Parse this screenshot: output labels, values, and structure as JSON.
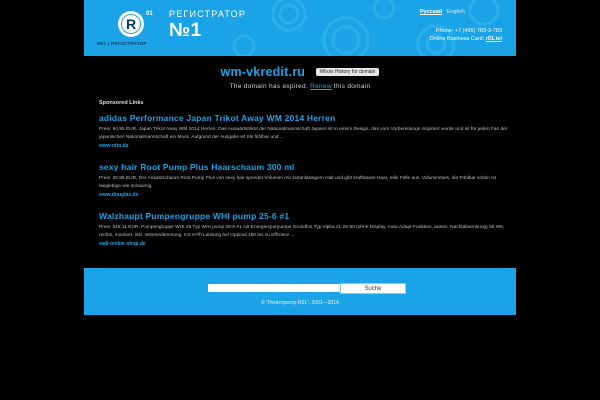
{
  "header": {
    "logo_caption": "R01 | РЕГИСТРАТОР",
    "logo_letter": "R",
    "logo_superscript": "01",
    "brand_title": "РЕГИСТРАТОР",
    "brand_number": "№1",
    "lang_active": "Русский",
    "lang_other": "English",
    "phone": "Phone: +7 (495) 783-3-783",
    "card_label": "Online Business Card: ",
    "card_link": "r01.tel"
  },
  "domain": {
    "name": "wm-vkredit.ru",
    "whois_label": "Whois History for domain",
    "status_prefix": "The domain has expired. ",
    "renew_label": "Renew",
    "status_suffix": " this domain"
  },
  "sponsored_label": "Sponsored Links",
  "ads": [
    {
      "title": "adidas Performance Japan Trikot Away WM 2014 Herren",
      "desc": "Preis: 84,95 EUR, Japan Trikot Away WM 2014 Herren: Das Auswärtstrikot der Nationalmannschaft Japans ist in einem Design, das vom Vorbereitungs inspiriert wurde und ist für jeden Fan der japanischen Nationalmannschaft ein Muss. Aufgrund der Ausgabe ist Stil fühlbar und ...",
      "url": "www.otto.de"
    },
    {
      "title": "sexy hair Root Pump Plus Haarschaum 300 ml",
      "desc": "Preis: 20,95 EUR, Der Ansatzschaum Root Pump Plus von sexy hair spendet Volumen mit zeitanlässigem Halt und gibt kraftlosem Haar, tolle Fülle aus. Voluminöses, die Fühlbar schön ist langlebige wie schaumig.",
      "url": "www.douglas.de"
    },
    {
      "title": "Walzhaupt Pumpengruppe WHI pump 25-6 #1",
      "desc": "Preis: 518,11 EUR, Pumpengruppe WHI 25 Typ WHI pump 25-6 #1 mit Energiesparpumpe Grundfos Typ Alpha 2L 25-60 (ohne Display, Auto-Adapt-Funktion, autom. Nachtabsenkung) 65 W6, rechts, montiert, inkl. Wärmedämmung, 0,5 m³/h Leistung bei Optimal 180 bis zu Effizienz ...",
      "url": "wall-online-shop.de"
    }
  ],
  "footer": {
    "search_placeholder": "",
    "search_button": "Suche",
    "copyright": "© “Регистратор R01”, 2001—2014"
  },
  "colors": {
    "brand_blue": "#1aa3e6",
    "background": "#000000",
    "dark_navy": "#0b3b5a"
  }
}
